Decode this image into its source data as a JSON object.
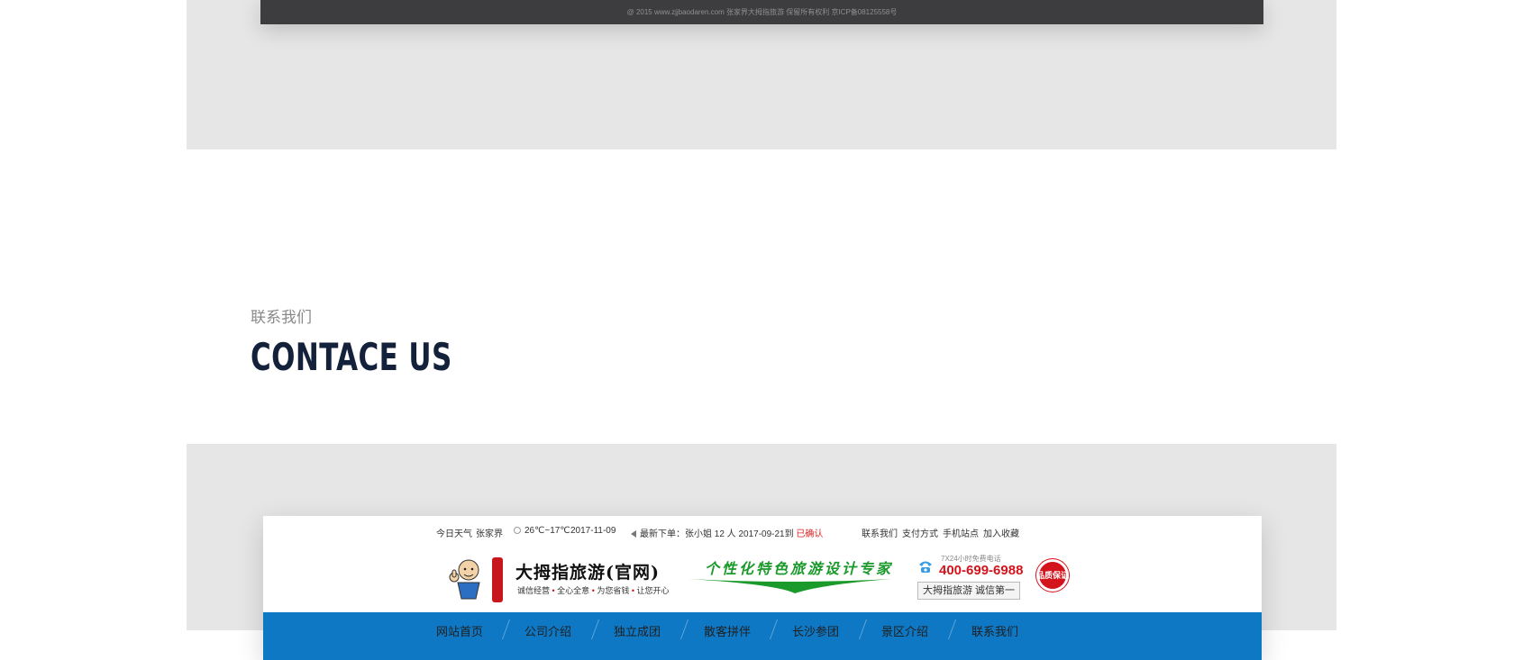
{
  "footer": {
    "copyright": "@ 2015 www.zjjbaodaren.com 张家界大拇指旅游 保留所有权利 京ICP备08125558号"
  },
  "section": {
    "subtitle": "联系我们",
    "title": "CONTACE US"
  },
  "preview": {
    "topbar": {
      "weather_label": "今日天气",
      "city": "张家界",
      "temperature": "26℃~17℃",
      "date": "2017-11-09",
      "order_label": "最新下单：张小姐 12 人 2017-09-21到",
      "order_status": "已确认",
      "links": [
        "联系我们",
        "支付方式",
        "手机站点",
        "加入收藏"
      ]
    },
    "brand": {
      "name": "大拇指旅游(官网)",
      "tagline_parts": [
        "诚信经营",
        "全心全意",
        "为您省钱",
        "让您开心"
      ],
      "slogan": "个性化特色旅游设计专家"
    },
    "contact": {
      "caption": "7X24小时免费电话",
      "phone": "400-699-6988",
      "box_text": "大拇指旅游  诚信第一",
      "seal": "品质保证"
    },
    "nav": [
      "网站首页",
      "公司介绍",
      "独立成团",
      "散客拼伴",
      "长沙参团",
      "景区介绍",
      "联系我们"
    ],
    "colors": {
      "nav_bg": "#0e78c4",
      "accent_red": "#d3141c",
      "slogan_green": "#1a9a2a"
    }
  }
}
